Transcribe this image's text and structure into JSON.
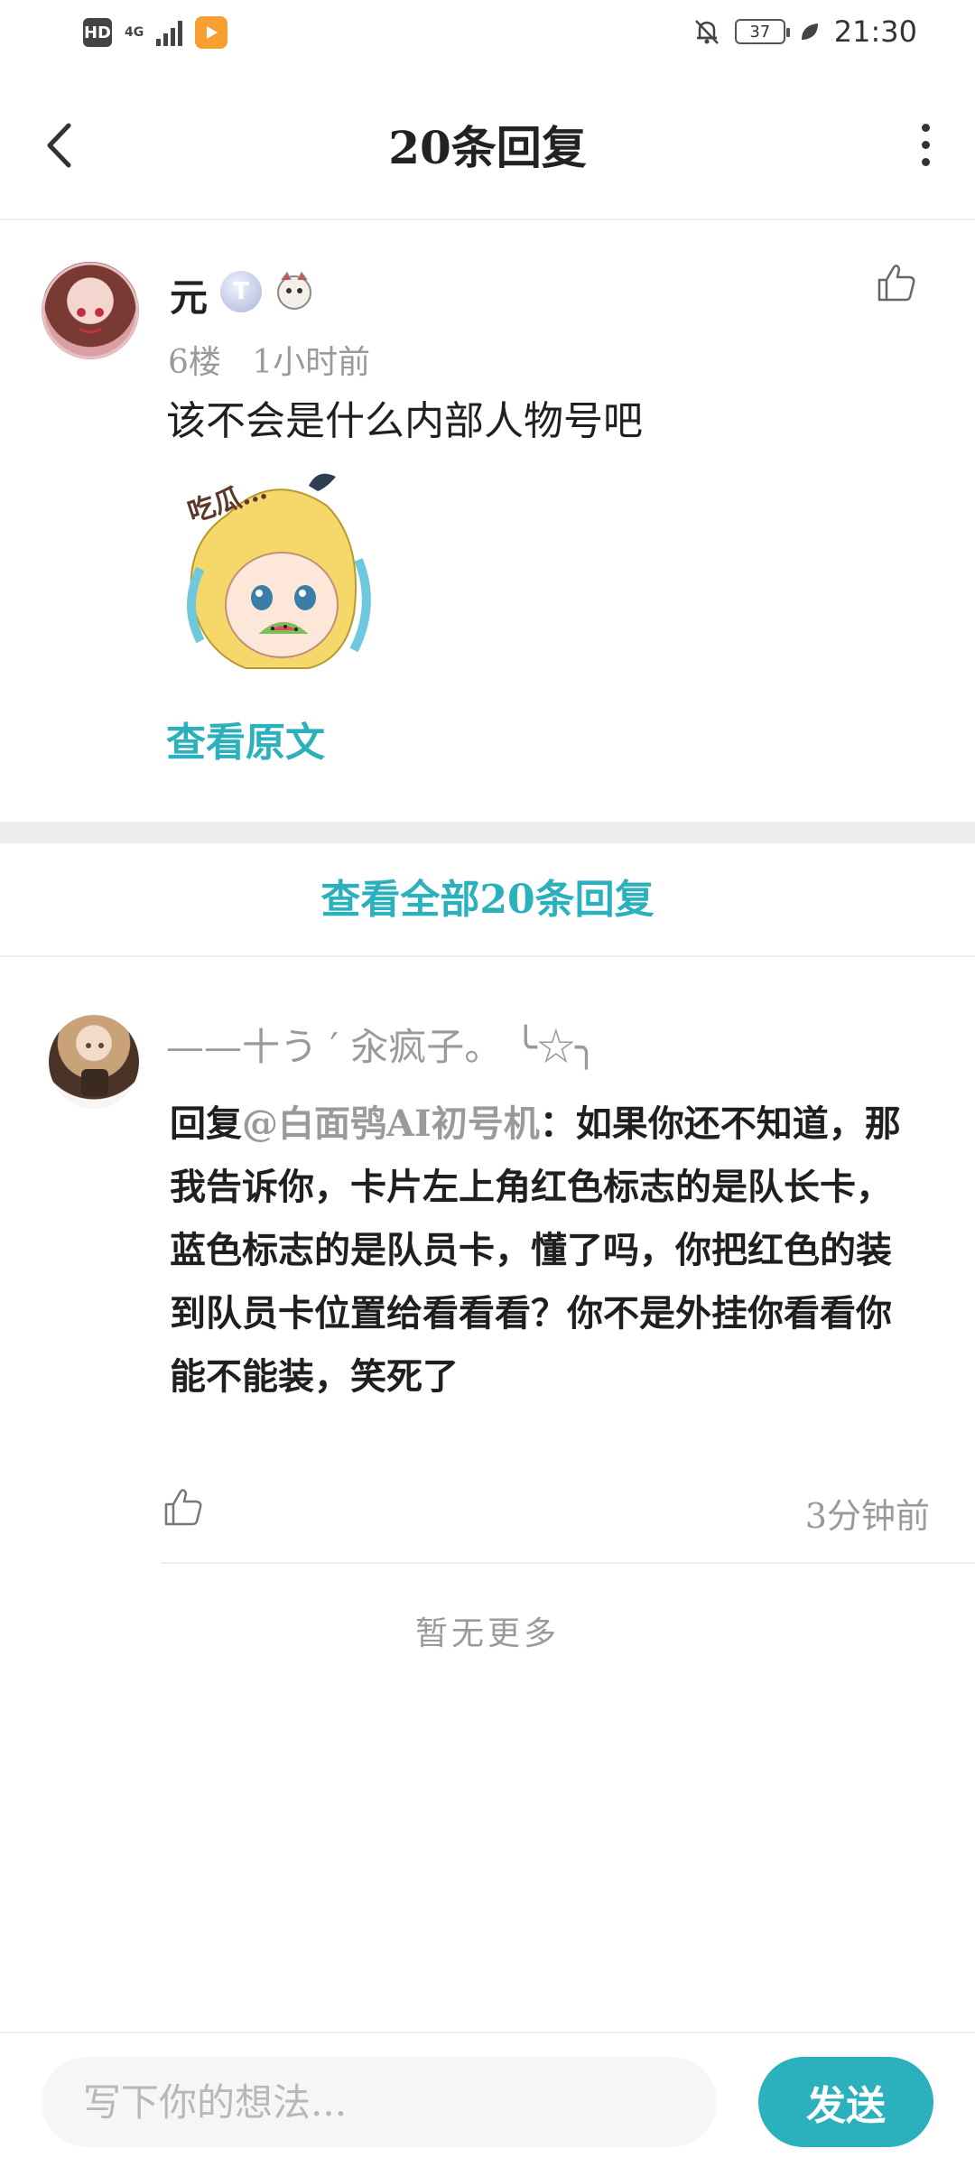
{
  "status_bar": {
    "hd": "HD",
    "network": "4G",
    "battery": "37",
    "time": "21:30"
  },
  "header": {
    "title": "20条回复"
  },
  "main_comment": {
    "author": "元",
    "level_badge": "T",
    "floor": "6楼",
    "time": "1小时前",
    "text": "该不会是什么内部人物号吧",
    "sticker_text": "吃瓜…",
    "view_original": "查看原文"
  },
  "view_all_label": "查看全部20条回复",
  "reply": {
    "author": "——十う ′ 汆疯子。 ╰☆╮",
    "reply_prefix": "回复",
    "mention": "@白面鸮AI初号机",
    "text": "：如果你还不知道，那我告诉你，卡片左上角红色标志的是队长卡，蓝色标志的是队员卡，懂了吗，你把红色的装到队员卡位置给看看看？你不是外挂你看看你能不能装，笑死了",
    "time": "3分钟前"
  },
  "no_more": "暂无更多",
  "bottom": {
    "placeholder": "写下你的想法...",
    "send_label": "发送"
  },
  "colors": {
    "accent": "#2bb0bd",
    "muted": "#9a9a9a"
  }
}
